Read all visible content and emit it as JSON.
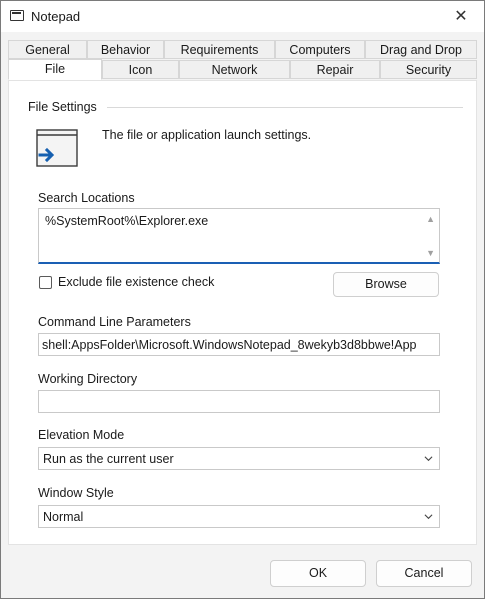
{
  "window": {
    "title": "Notepad"
  },
  "tabs": {
    "row1": [
      "General",
      "Behavior",
      "Requirements",
      "Computers",
      "Drag and Drop"
    ],
    "row2": [
      "File",
      "Icon",
      "Network",
      "Repair",
      "Security"
    ],
    "active": "File"
  },
  "file_settings": {
    "section_title": "File Settings",
    "description": "The file or application launch settings.",
    "search_locations_label": "Search Locations",
    "search_locations_value": "%SystemRoot%\\Explorer.exe",
    "exclude_check_label": "Exclude file existence check",
    "exclude_checked": false,
    "browse_label": "Browse",
    "cmdline_label": "Command Line Parameters",
    "cmdline_value": "shell:AppsFolder\\Microsoft.WindowsNotepad_8wekyb3d8bbwe!App",
    "workdir_label": "Working Directory",
    "workdir_value": "",
    "elevation_label": "Elevation Mode",
    "elevation_value": "Run as the current user",
    "window_style_label": "Window Style",
    "window_style_value": "Normal"
  },
  "footer": {
    "ok_label": "OK",
    "cancel_label": "Cancel"
  },
  "icons": {
    "app": "window-icon",
    "close": "close-icon",
    "file": "file-launch-icon",
    "dropdown": "chevron-down-icon"
  },
  "colors": {
    "accent": "#1a5fb4",
    "icon_blue": "#1660b0"
  }
}
